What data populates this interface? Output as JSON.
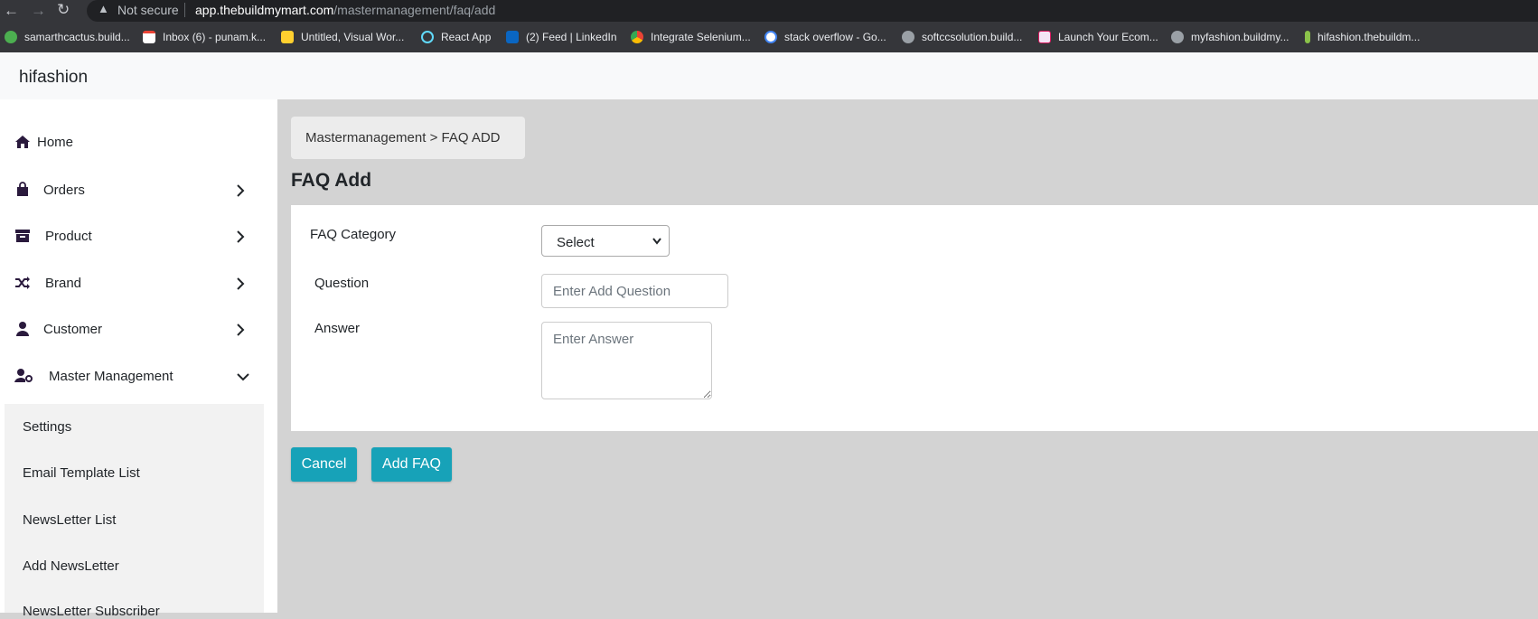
{
  "browser": {
    "security_label": "Not secure",
    "url_host": "app.thebuildmymart.com",
    "url_path": "/mastermanagement/faq/add",
    "bookmarks": [
      {
        "label": "samarthcactus.build...",
        "icon": "bookmark-favicon",
        "color": "#4caf50"
      },
      {
        "label": "Inbox (6) - punam.k...",
        "icon": "gmail-icon",
        "color": "#ea4335"
      },
      {
        "label": "Untitled, Visual Wor...",
        "icon": "miro-icon",
        "color": "#ffd02f"
      },
      {
        "label": "React App",
        "icon": "react-icon",
        "color": "#61dafb"
      },
      {
        "label": "(2) Feed | LinkedIn",
        "icon": "linkedin-icon",
        "color": "#0a66c2"
      },
      {
        "label": "Integrate Selenium...",
        "icon": "chrome-icon",
        "color": "#fbbc04"
      },
      {
        "label": "stack overflow - Go...",
        "icon": "google-icon",
        "color": "#4285f4"
      },
      {
        "label": "softccsolution.build...",
        "icon": "globe-icon",
        "color": "#9aa0a6"
      },
      {
        "label": "Launch Your Ecom...",
        "icon": "store-icon",
        "color": "#d81b60"
      },
      {
        "label": "myfashion.buildmy...",
        "icon": "globe-icon",
        "color": "#9aa0a6"
      },
      {
        "label": "hifashion.thebuildm...",
        "icon": "leaf-icon",
        "color": "#8bc34a"
      }
    ]
  },
  "app": {
    "brand": "hifashion"
  },
  "sidebar": {
    "items": [
      {
        "label": "Home",
        "icon": "home-icon"
      },
      {
        "label": "Orders",
        "icon": "shopping-bag-icon"
      },
      {
        "label": "Product",
        "icon": "archive-box-icon"
      },
      {
        "label": "Brand",
        "icon": "shuffle-icon"
      },
      {
        "label": "Customer",
        "icon": "user-icon"
      },
      {
        "label": "Master Management",
        "icon": "user-cog-icon"
      }
    ],
    "submenu": [
      {
        "label": "Settings"
      },
      {
        "label": "Email Template List"
      },
      {
        "label": "NewsLetter List"
      },
      {
        "label": "Add NewsLetter"
      },
      {
        "label": "NewsLetter Subscriber"
      }
    ]
  },
  "main": {
    "breadcrumb": "Mastermanagement > FAQ ADD",
    "title": "FAQ Add",
    "form": {
      "category_label": "FAQ Category",
      "category_selected": "Select",
      "question_label": "Question",
      "question_placeholder": "Enter Add Question",
      "answer_label": "Answer",
      "answer_placeholder": "Enter Answer"
    },
    "buttons": {
      "cancel": "Cancel",
      "add": "Add FAQ"
    },
    "button_color": "#17a2b8"
  }
}
